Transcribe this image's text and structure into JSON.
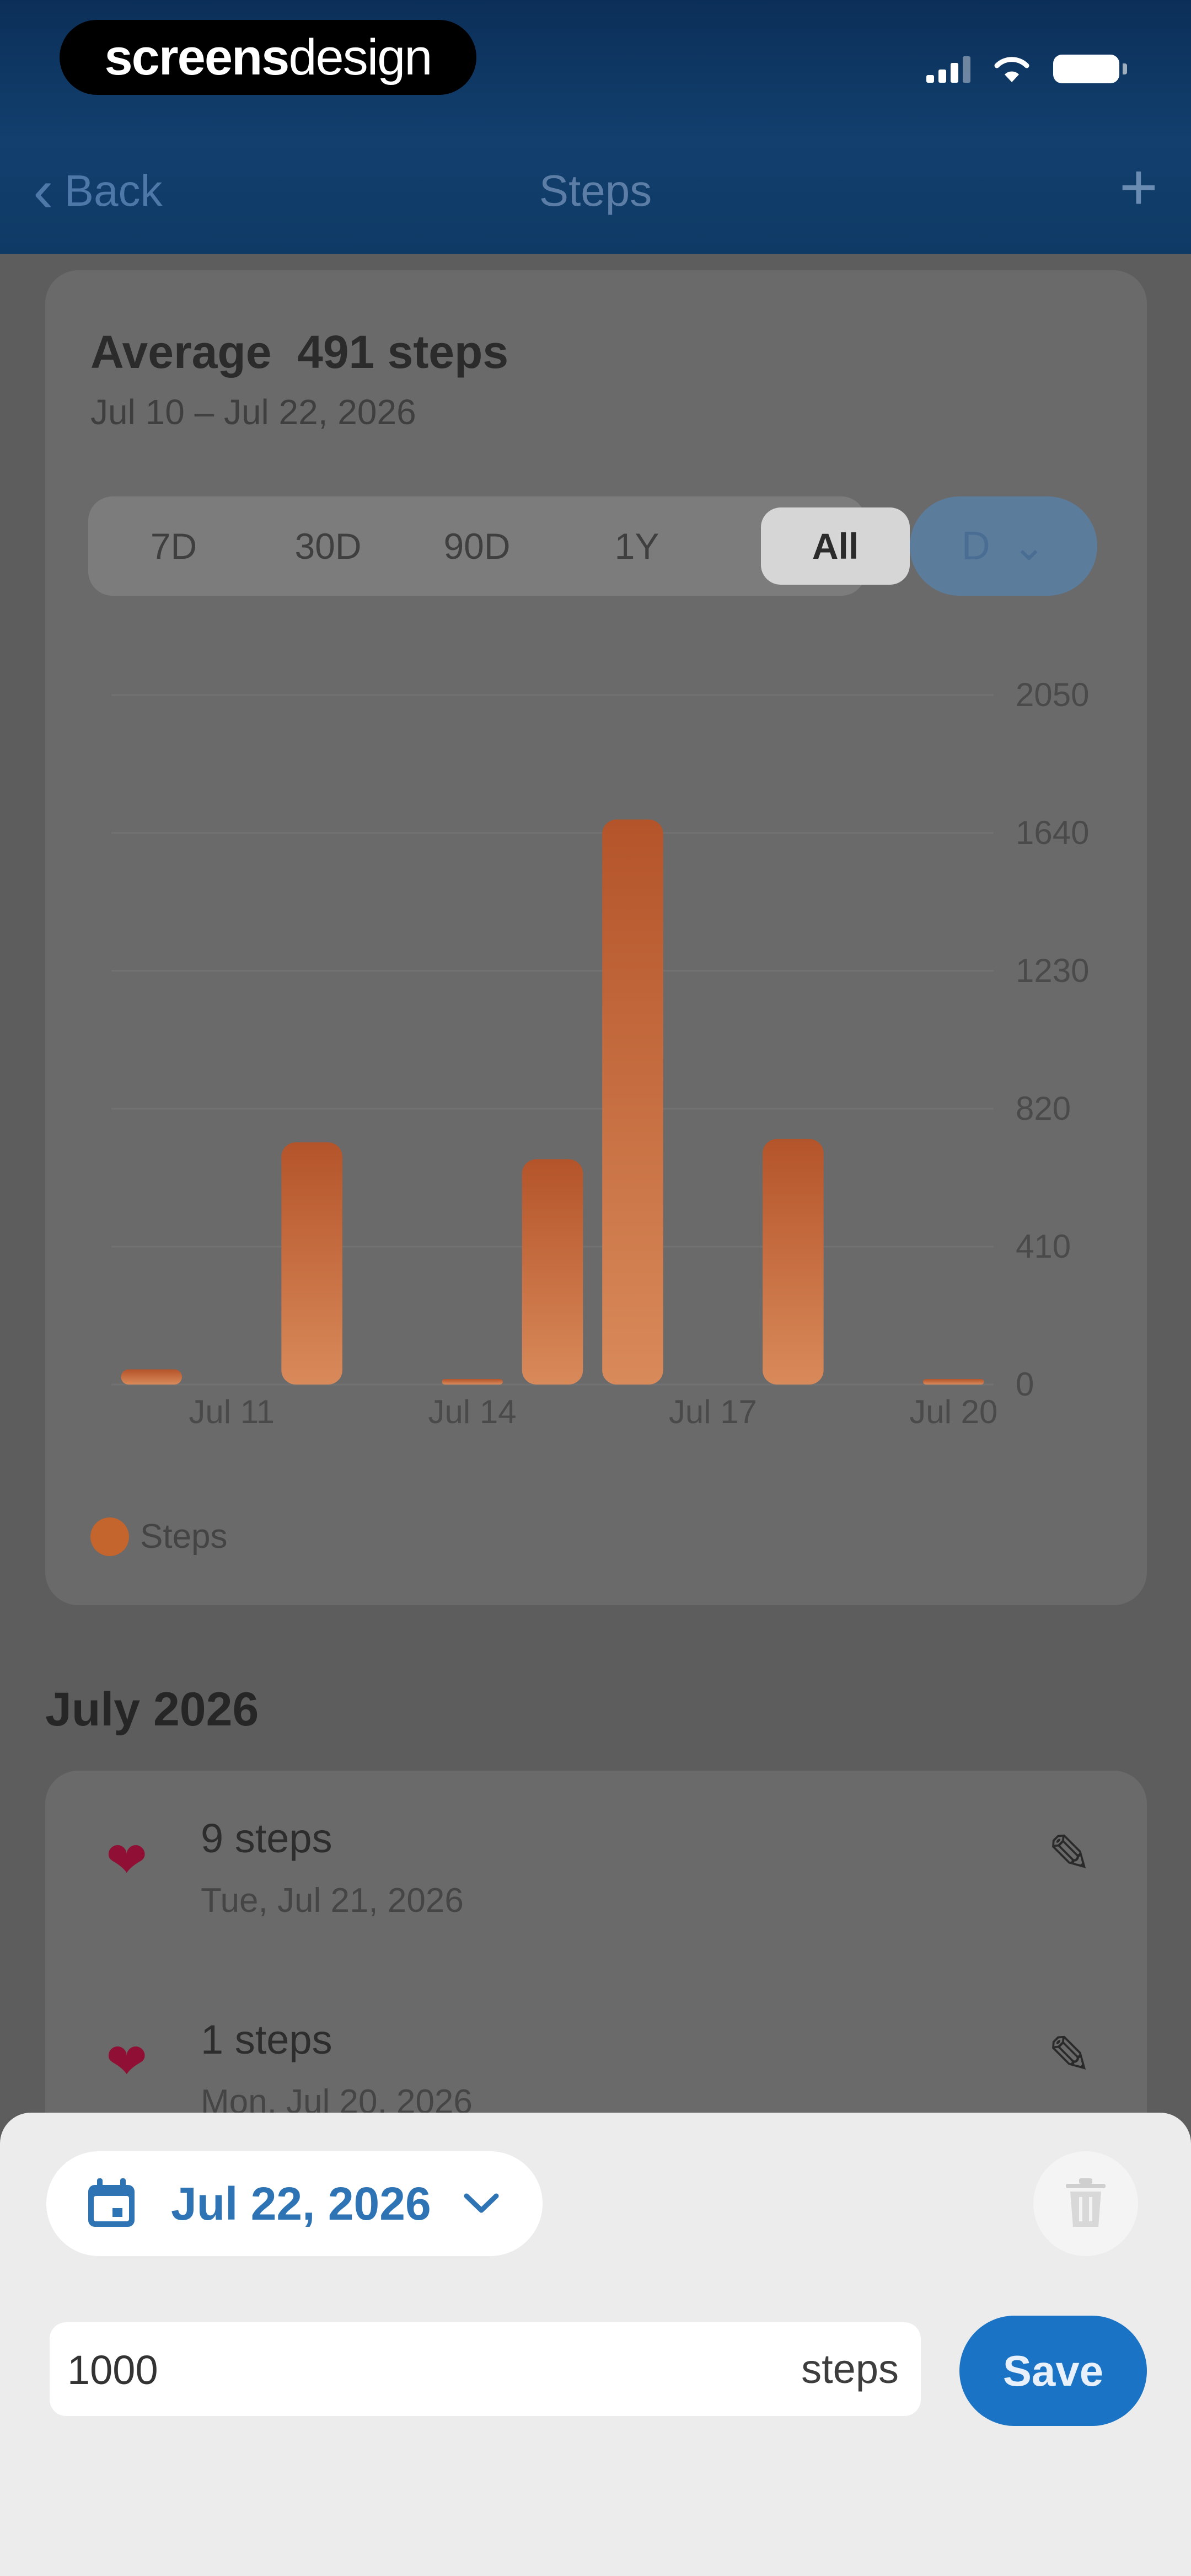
{
  "watermark": {
    "bold": "screens",
    "light": "design"
  },
  "nav": {
    "back_label": "Back",
    "title": "Steps",
    "add_label": "+"
  },
  "summary": {
    "average_label": "Average",
    "average_value": "491 steps",
    "range": "Jul 10 – Jul 22, 2026"
  },
  "periods": [
    {
      "label": "7D",
      "active": false
    },
    {
      "label": "30D",
      "active": false
    },
    {
      "label": "90D",
      "active": false
    },
    {
      "label": "1Y",
      "active": false
    },
    {
      "label": "All",
      "active": true
    }
  ],
  "granularity": {
    "label": "D"
  },
  "chart_data": {
    "type": "bar",
    "x": [
      "Jul 10",
      "Jul 11",
      "Jul 12",
      "Jul 13",
      "Jul 14",
      "Jul 15",
      "Jul 16",
      "Jul 17",
      "Jul 18",
      "Jul 19",
      "Jul 20"
    ],
    "values": [
      45,
      0,
      720,
      0,
      9,
      670,
      1680,
      0,
      730,
      0,
      1
    ],
    "x_tick_labels": [
      "Jul 11",
      "Jul 14",
      "Jul 17",
      "Jul 20"
    ],
    "y_ticks": [
      0,
      410,
      820,
      1230,
      1640,
      2050
    ],
    "ylim": [
      0,
      2050
    ],
    "legend": [
      "Steps"
    ],
    "bar_color": "#c4652e",
    "grid": true
  },
  "month_header": "July 2026",
  "entries": [
    {
      "value": "9 steps",
      "date": "Tue, Jul 21, 2026"
    },
    {
      "value": "1 steps",
      "date": "Mon, Jul 20, 2026"
    }
  ],
  "sheet": {
    "date": "Jul 22, 2026",
    "input_value": "1000",
    "unit": "steps",
    "save_label": "Save"
  },
  "colors": {
    "accent": "#1a73c4",
    "header": "#0f3a66",
    "bar": "#c4652e",
    "heart": "#8f1034"
  }
}
